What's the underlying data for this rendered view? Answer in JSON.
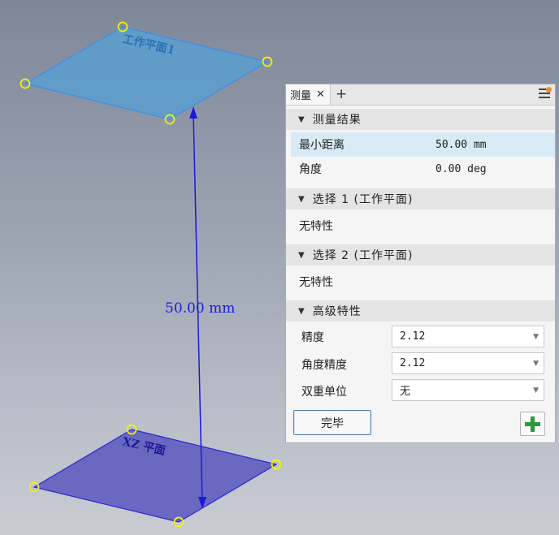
{
  "viewport": {
    "top_plane_label": "工作平面1",
    "bottom_plane_label": "XZ 平面",
    "dimension_text": "50.00 mm",
    "colors": {
      "top_plane": "#5b9fd0",
      "bottom_plane": "#5f5ec0",
      "dimension": "#1a1adc",
      "grip_points": "#f2f200"
    }
  },
  "panel": {
    "tab_label": "测量",
    "close_icon": "close-icon",
    "add_tab_icon": "plus-icon",
    "menu_icon": "hamburger-menu-icon",
    "results": {
      "header": "测量结果",
      "rows": [
        {
          "label": "最小距离",
          "value": "50.00 mm"
        },
        {
          "label": "角度",
          "value": "0.00 deg"
        }
      ]
    },
    "selection1": {
      "header": "选择 1 (工作平面)",
      "content": "无特性"
    },
    "selection2": {
      "header": "选择 2 (工作平面)",
      "content": "无特性"
    },
    "advanced": {
      "header": "高级特性",
      "properties": [
        {
          "label": "精度",
          "value": "2.12"
        },
        {
          "label": "角度精度",
          "value": "2.12"
        },
        {
          "label": "双重单位",
          "value": "无"
        }
      ]
    },
    "done_label": "完毕",
    "add_icon": "green-plus-icon"
  }
}
